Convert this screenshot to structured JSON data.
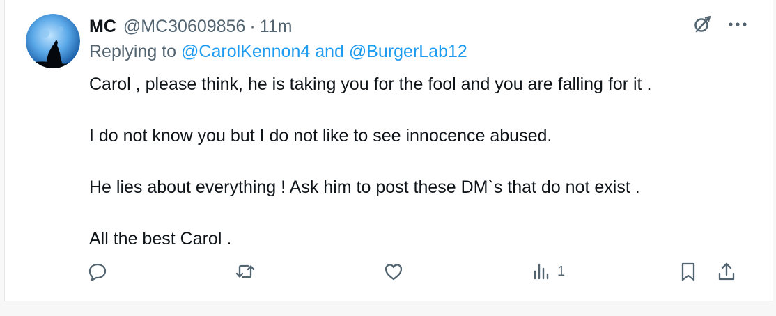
{
  "post": {
    "author_name": "MC",
    "author_handle": "@MC30609856",
    "separator": "·",
    "time": "11m",
    "replying_prefix": "Replying to ",
    "replying_to_1": "@CarolKennon4",
    "replying_and": " and ",
    "replying_to_2": "@BurgerLab12",
    "paragraphs": [
      "Carol , please think, he is taking you for the fool and you are falling for it .",
      "I do not know you but I do not like to see innocence abused.",
      "He lies about everything ! Ask him to post these DM`s that do not exist .",
      "All the best Carol ."
    ],
    "views_count": "1"
  },
  "icons": {
    "avatar": "wolf-howling-at-moon-avatar",
    "grok": "grok-icon",
    "more": "more-icon",
    "reply": "reply-icon",
    "repost": "repost-icon",
    "like": "like-icon",
    "views": "views-icon",
    "bookmark": "bookmark-icon",
    "share": "share-icon"
  },
  "colors": {
    "link": "#1d9bf0",
    "secondary_text": "#536471",
    "primary_text": "#0f1419"
  }
}
